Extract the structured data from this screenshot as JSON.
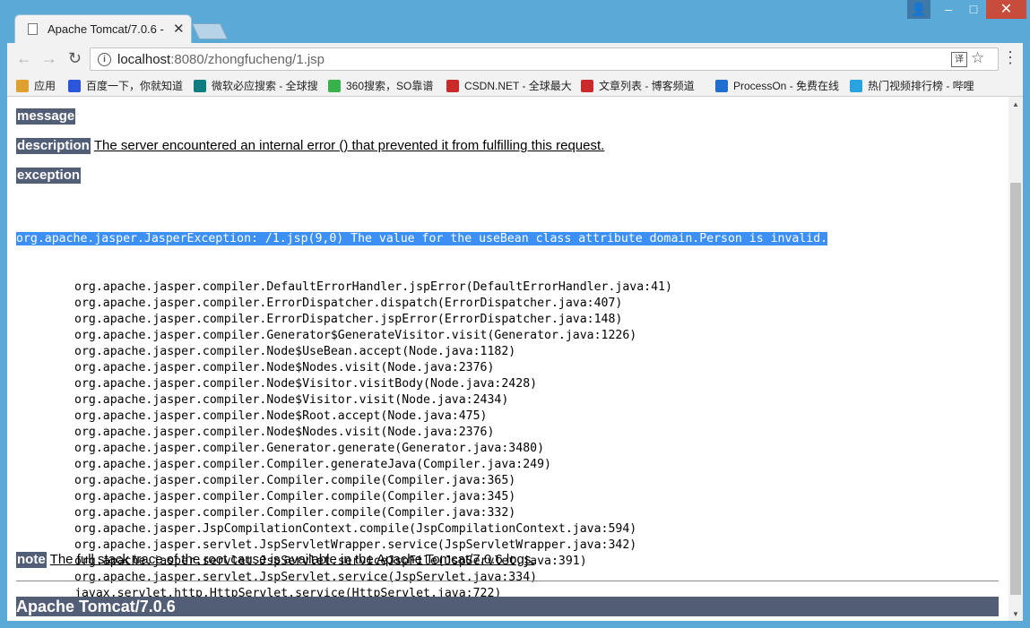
{
  "browser": {
    "tab_title": "Apache Tomcat/7.0.6 -",
    "url_host": "localhost",
    "url_rest": ":8080/zhongfucheng/1.jsp",
    "bookmarks": [
      {
        "label": "应用",
        "color": "#e0a030"
      },
      {
        "label": "百度一下，你就知道",
        "color": "#2b56d9"
      },
      {
        "label": "微软必应搜索 - 全球搜",
        "color": "#0f7d80"
      },
      {
        "label": "360搜索，SO靠谱",
        "color": "#38b24a"
      },
      {
        "label": "CSDN.NET - 全球最大",
        "color": "#c92a2a"
      },
      {
        "label": "文章列表 - 博客频道",
        "color": "#c92a2a"
      },
      {
        "label": "ProcessOn - 免费在线",
        "color": "#1f6fd1"
      },
      {
        "label": "热门视频排行榜 - 哔哩",
        "color": "#27a3e0"
      }
    ]
  },
  "error_page": {
    "message_label": "message",
    "description_label": "description",
    "description_text": "The server encountered an internal error () that prevented it from fulfilling this request.",
    "exception_label": "exception",
    "exception_first": "org.apache.jasper.JasperException: /1.jsp(9,0) The value for the useBean class attribute domain.Person is invalid.",
    "trace": [
      "org.apache.jasper.compiler.DefaultErrorHandler.jspError(DefaultErrorHandler.java:41)",
      "org.apache.jasper.compiler.ErrorDispatcher.dispatch(ErrorDispatcher.java:407)",
      "org.apache.jasper.compiler.ErrorDispatcher.jspError(ErrorDispatcher.java:148)",
      "org.apache.jasper.compiler.Generator$GenerateVisitor.visit(Generator.java:1226)",
      "org.apache.jasper.compiler.Node$UseBean.accept(Node.java:1182)",
      "org.apache.jasper.compiler.Node$Nodes.visit(Node.java:2376)",
      "org.apache.jasper.compiler.Node$Visitor.visitBody(Node.java:2428)",
      "org.apache.jasper.compiler.Node$Visitor.visit(Node.java:2434)",
      "org.apache.jasper.compiler.Node$Root.accept(Node.java:475)",
      "org.apache.jasper.compiler.Node$Nodes.visit(Node.java:2376)",
      "org.apache.jasper.compiler.Generator.generate(Generator.java:3480)",
      "org.apache.jasper.compiler.Compiler.generateJava(Compiler.java:249)",
      "org.apache.jasper.compiler.Compiler.compile(Compiler.java:365)",
      "org.apache.jasper.compiler.Compiler.compile(Compiler.java:345)",
      "org.apache.jasper.compiler.Compiler.compile(Compiler.java:332)",
      "org.apache.jasper.JspCompilationContext.compile(JspCompilationContext.java:594)",
      "org.apache.jasper.servlet.JspServletWrapper.service(JspServletWrapper.java:342)",
      "org.apache.jasper.servlet.JspServlet.serviceJspFile(JspServlet.java:391)",
      "org.apache.jasper.servlet.JspServlet.service(JspServlet.java:334)",
      "javax.servlet.http.HttpServlet.service(HttpServlet.java:722)"
    ],
    "note_label": "note",
    "note_text": "The full stack trace of the root cause is available in the Apache Tomcat/7.0.6 logs.",
    "footer": "Apache Tomcat/7.0.6"
  }
}
